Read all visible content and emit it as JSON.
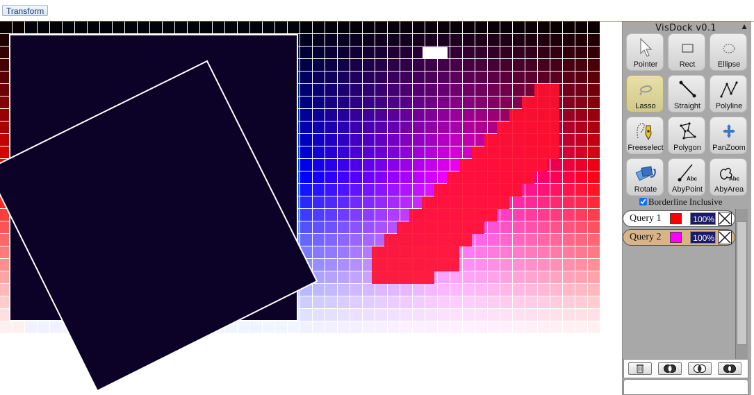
{
  "toolbar": {
    "transform_label": "Transform"
  },
  "dock": {
    "title": "VisDock v0.1",
    "collapse_glyph": "▲",
    "tools": [
      {
        "id": "pointer",
        "label": "Pointer",
        "icon": "pointer-icon",
        "active": false
      },
      {
        "id": "rect",
        "label": "Rect",
        "icon": "rect-icon",
        "active": false
      },
      {
        "id": "ellipse",
        "label": "Ellipse",
        "icon": "ellipse-icon",
        "active": false
      },
      {
        "id": "lasso",
        "label": "Lasso",
        "icon": "lasso-icon",
        "active": true
      },
      {
        "id": "straight",
        "label": "Straight",
        "icon": "straight-line-icon",
        "active": false
      },
      {
        "id": "polyline",
        "label": "Polyline",
        "icon": "polyline-icon",
        "active": false
      },
      {
        "id": "freeselect",
        "label": "Freeselect",
        "icon": "freeselect-icon",
        "active": false
      },
      {
        "id": "polygon",
        "label": "Polygon",
        "icon": "polygon-icon",
        "active": false
      },
      {
        "id": "panzoom",
        "label": "PanZoom",
        "icon": "panzoom-icon",
        "active": false
      },
      {
        "id": "rotate",
        "label": "Rotate",
        "icon": "rotate-icon",
        "active": false
      },
      {
        "id": "abypoint",
        "label": "AbyPoint",
        "icon": "annotate-point-icon",
        "active": false
      },
      {
        "id": "abyarea",
        "label": "AbyArea",
        "icon": "annotate-area-icon",
        "active": false
      }
    ],
    "icon_text": "Abc",
    "borderline_label": "Borderline Inclusive",
    "borderline_checked": true,
    "queries": [
      {
        "name": "Query 1",
        "color": "#ff0000",
        "opacity": "100%",
        "background": "#ffffff"
      },
      {
        "name": "Query 2",
        "color": "#ff00ff",
        "opacity": "100%",
        "background": "#d8b486"
      }
    ],
    "boolean_ops": [
      "clear-icon",
      "intersect-icon",
      "union-icon",
      "xor-icon"
    ]
  },
  "colors": {
    "selection_fill": "#0c0228",
    "selection_stroke": "#ffffff",
    "highlight": "#ff1030",
    "marker": "#ffffff"
  }
}
